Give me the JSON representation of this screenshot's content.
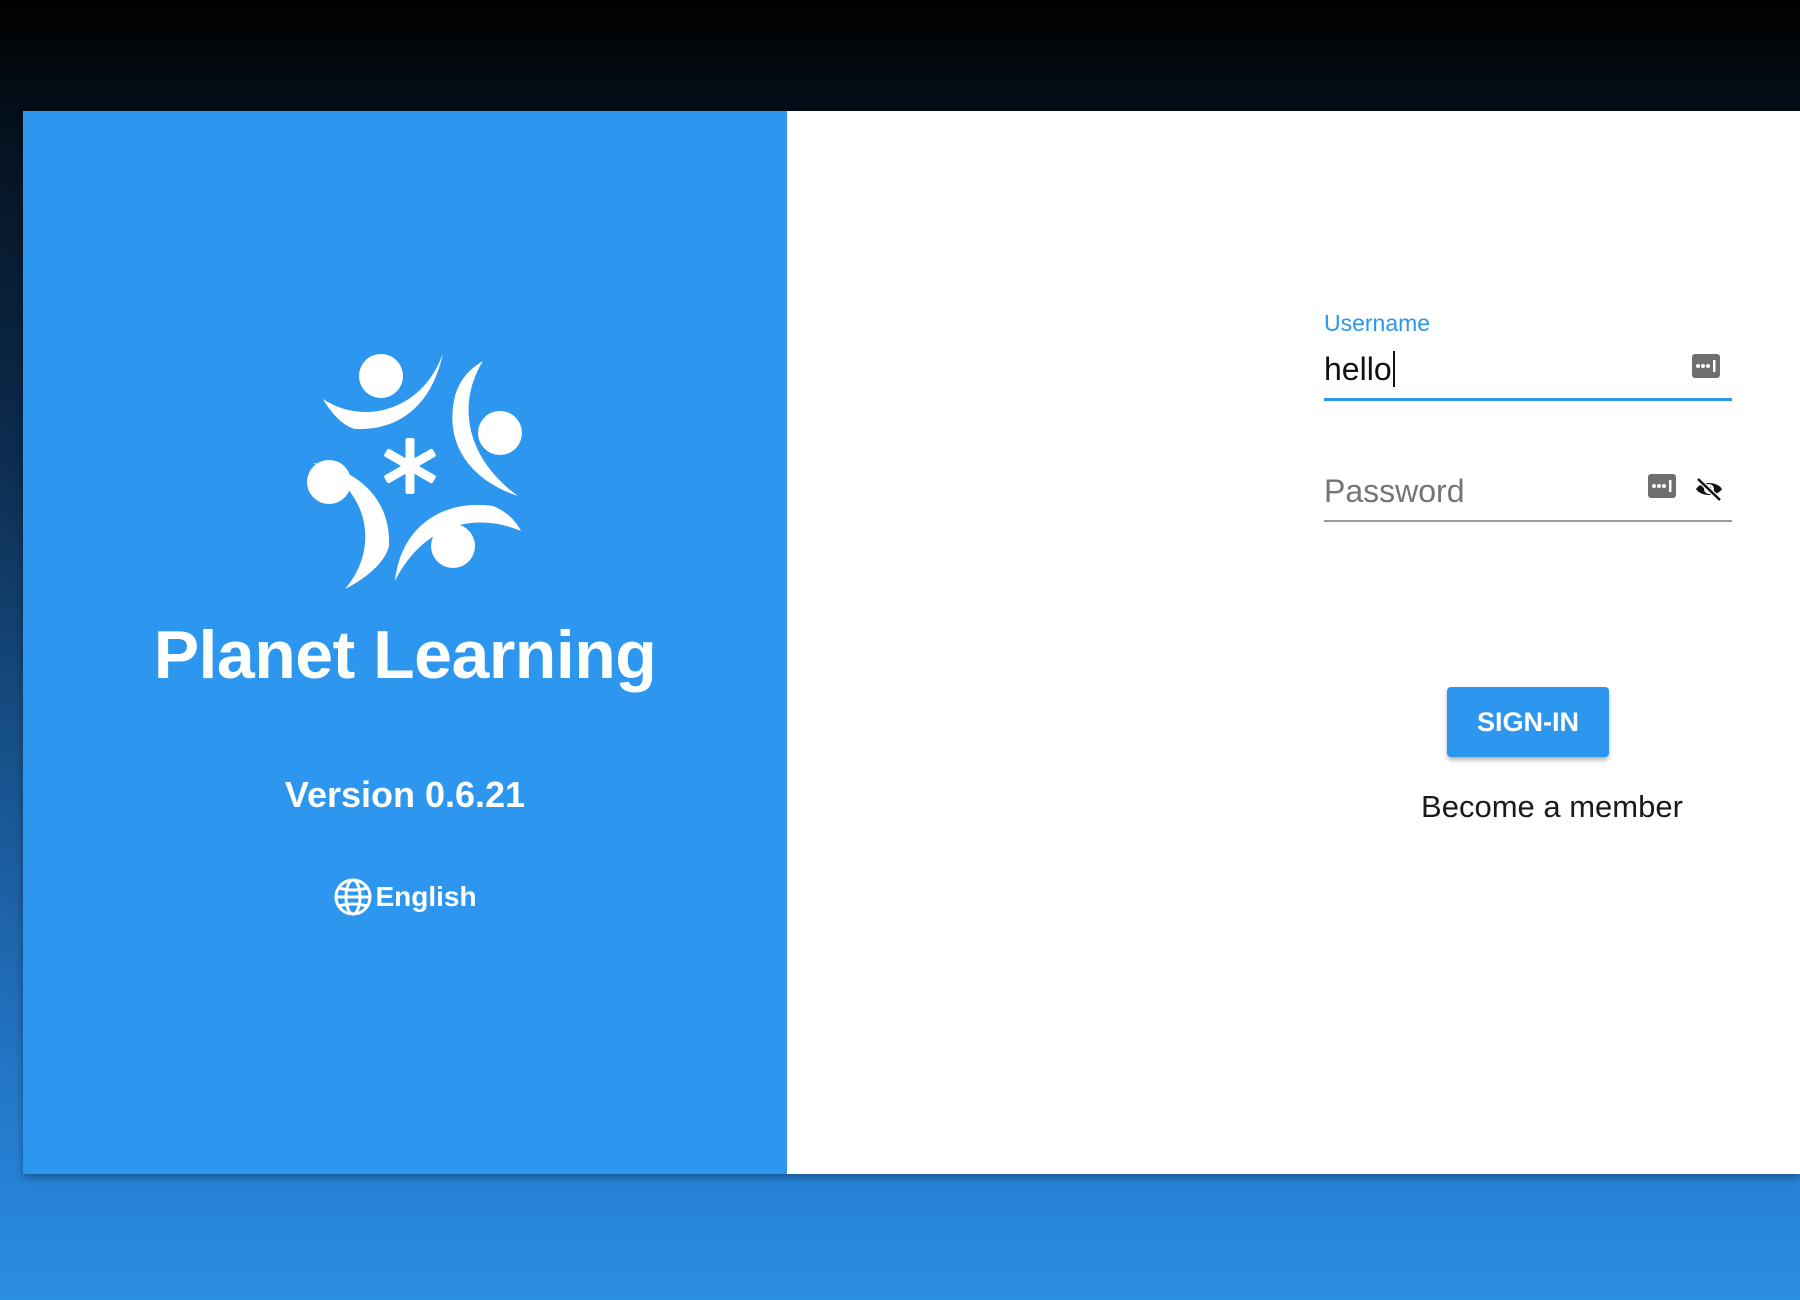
{
  "app": {
    "title": "Planet Learning",
    "version": "Version 0.6.21",
    "language": "English",
    "logo": "planet-learning-logo"
  },
  "login": {
    "username_label": "Username",
    "username_value": "hello",
    "password_placeholder": "Password",
    "signin_label": "SIGN-IN",
    "become_member_label": "Become a member"
  },
  "icons": {
    "language": "globe-icon",
    "keychain": "password-manager-key-icon",
    "password_visibility": "eye-off-icon"
  },
  "colors": {
    "brand": "#2d96ee",
    "panel_background": "#ffffff"
  }
}
